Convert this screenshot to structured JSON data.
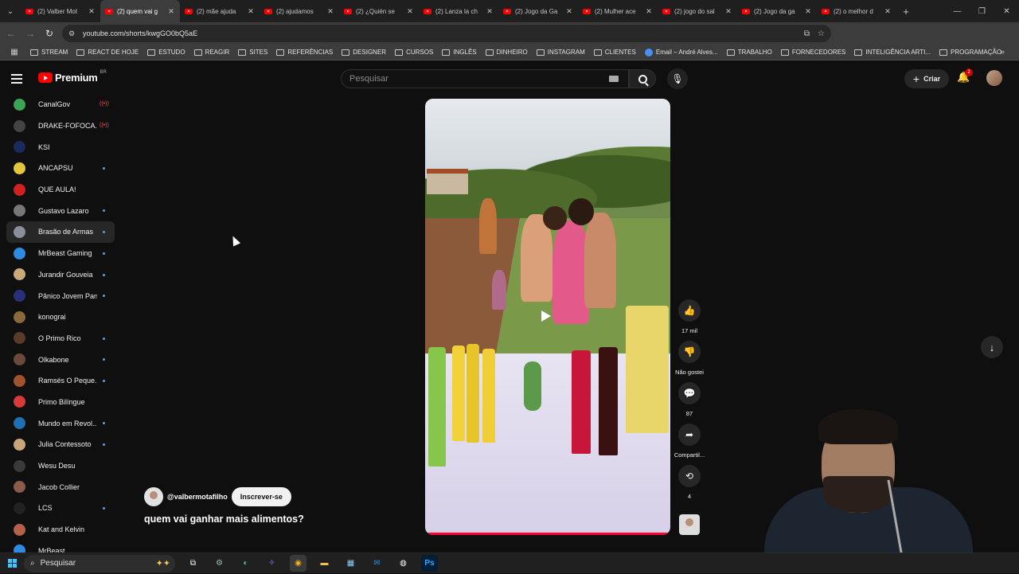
{
  "browser": {
    "tabs": [
      {
        "label": "(2) Valber Mot"
      },
      {
        "label": "(2) quem vai g",
        "active": true
      },
      {
        "label": "(2) mãe ajuda"
      },
      {
        "label": "(2) ajudamos"
      },
      {
        "label": "(2) ¿Quién se"
      },
      {
        "label": "(2) Lanza la ch"
      },
      {
        "label": "(2) Jogo da Ga"
      },
      {
        "label": "(2) Mulher ace"
      },
      {
        "label": "(2) jogo do sal"
      },
      {
        "label": "(2) Jogo da ga"
      },
      {
        "label": "(2) o melhor d"
      }
    ],
    "tab_close_glyph": "✕",
    "new_tab_glyph": "+",
    "url": "youtube.com/shorts/kwgGO0bQ5aE",
    "bookmarks": [
      {
        "label": "STREAM"
      },
      {
        "label": "REACT DE HOJE"
      },
      {
        "label": "ESTUDO"
      },
      {
        "label": "REAGIR"
      },
      {
        "label": "SITES"
      },
      {
        "label": "REFERÊNCIAS"
      },
      {
        "label": "DESIGNER"
      },
      {
        "label": "CURSOS"
      },
      {
        "label": "INGLÊS"
      },
      {
        "label": "DINHEIRO"
      },
      {
        "label": "INSTAGRAM"
      },
      {
        "label": "CLIENTES"
      },
      {
        "label": "Email – André Alves...",
        "google": true
      },
      {
        "label": "TRABALHO"
      },
      {
        "label": "FORNECEDORES"
      },
      {
        "label": "INTELIGÊNCIA ARTI..."
      },
      {
        "label": "PROGRAMAÇÃO"
      }
    ]
  },
  "youtube": {
    "logo_text": "Premium",
    "country_code": "BR",
    "search_placeholder": "Pesquisar",
    "create_label": "Criar",
    "notification_count": "2",
    "subscriptions": [
      {
        "name": "CanalGov",
        "status": "live",
        "color": "#3aa655"
      },
      {
        "name": "DRAKE-FOFOCA...",
        "status": "live",
        "color": "#444"
      },
      {
        "name": "KSI",
        "status": "none",
        "color": "#1b2a5c"
      },
      {
        "name": "ANCAPSU",
        "status": "dot",
        "color": "#e5c53a"
      },
      {
        "name": "QUE AULA!",
        "status": "none",
        "color": "#d21f1f"
      },
      {
        "name": "Gustavo Lazaro",
        "status": "dot",
        "color": "#777"
      },
      {
        "name": "Brasão de Armas",
        "status": "dot",
        "color": "#8a8f9a",
        "highlight": true
      },
      {
        "name": "MrBeast Gaming",
        "status": "dot",
        "color": "#2f8be0"
      },
      {
        "name": "Jurandir Gouveia",
        "status": "dot",
        "color": "#c9a87a"
      },
      {
        "name": "Pânico Jovem Pan",
        "status": "dot",
        "color": "#2a2f7a"
      },
      {
        "name": "konograi",
        "status": "none",
        "color": "#8a6a3a"
      },
      {
        "name": "O Primo Rico",
        "status": "dot",
        "color": "#5a3a2a"
      },
      {
        "name": "Olkabone",
        "status": "dot",
        "color": "#6a4a3a"
      },
      {
        "name": "Ramsés O Peque...",
        "status": "dot",
        "color": "#a0522d"
      },
      {
        "name": "Primo Bilíngue",
        "status": "none",
        "color": "#d83a3a"
      },
      {
        "name": "Mundo em Revol...",
        "status": "dot",
        "color": "#1f6fb5"
      },
      {
        "name": "Julia Contessoto",
        "status": "dot",
        "color": "#c8a67a"
      },
      {
        "name": "Wesu Desu",
        "status": "none",
        "color": "#3a3a3a"
      },
      {
        "name": "Jacob Collier",
        "status": "none",
        "color": "#8a5a4a"
      },
      {
        "name": "LCS",
        "status": "dot",
        "color": "#222"
      },
      {
        "name": "Kat and Kelvin",
        "status": "none",
        "color": "#b5614a"
      },
      {
        "name": "MrBeast",
        "status": "none",
        "color": "#2f8be0"
      }
    ],
    "short": {
      "channel_handle": "@valbermotafilho",
      "subscribe_label": "Inscrever-se",
      "title": "quem vai ganhar mais alimentos?",
      "progress": 1.0
    },
    "actions": {
      "like_count": "17 mil",
      "dislike_label": "Não gostei",
      "comment_count": "87",
      "share_label": "Compartil...",
      "remix_count": "4"
    }
  },
  "taskbar": {
    "search_placeholder": "Pesquisar"
  }
}
